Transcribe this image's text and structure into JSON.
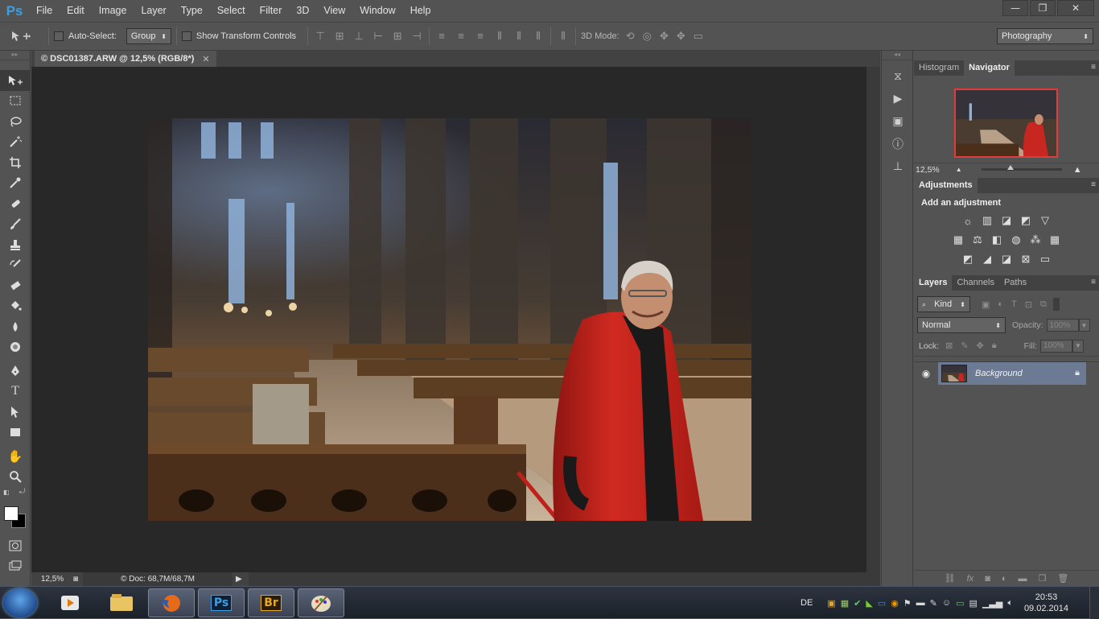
{
  "app": {
    "logo": "Ps",
    "menu": [
      "File",
      "Edit",
      "Image",
      "Layer",
      "Type",
      "Select",
      "Filter",
      "3D",
      "View",
      "Window",
      "Help"
    ],
    "window_controls": {
      "minimize": "—",
      "restore": "❐",
      "close": "✕"
    }
  },
  "options": {
    "auto_select_label": "Auto-Select:",
    "auto_select_value": "Group",
    "show_transform_label": "Show Transform Controls",
    "mode_label": "3D Mode:",
    "workspace": "Photography"
  },
  "document": {
    "tab_title": "© DSC01387.ARW @ 12,5% (RGB/8*)",
    "close": "✕",
    "status_zoom": "12,5%",
    "status_doc": "© Doc: 68,7M/68,7M"
  },
  "panels": {
    "top_tabs": [
      "Histogram",
      "Navigator"
    ],
    "navigator_zoom": "12,5%",
    "adjustments_tab": "Adjustments",
    "adjustments_title": "Add an adjustment",
    "layers_tabs": [
      "Layers",
      "Channels",
      "Paths"
    ],
    "kind_filter": "Kind",
    "blend_mode": "Normal",
    "opacity_label": "Opacity:",
    "opacity_value": "100%",
    "lock_label": "Lock:",
    "fill_label": "Fill:",
    "fill_value": "100%",
    "layer_name": "Background"
  },
  "taskbar": {
    "apps": [
      "Ps",
      "Br"
    ],
    "lang": "DE",
    "time": "20:53",
    "date": "09.02.2014"
  },
  "colors": {
    "accent_ps": "#39a0e8",
    "selected_layer": "#6c7a94",
    "navigator_frame": "#e23b3b"
  }
}
